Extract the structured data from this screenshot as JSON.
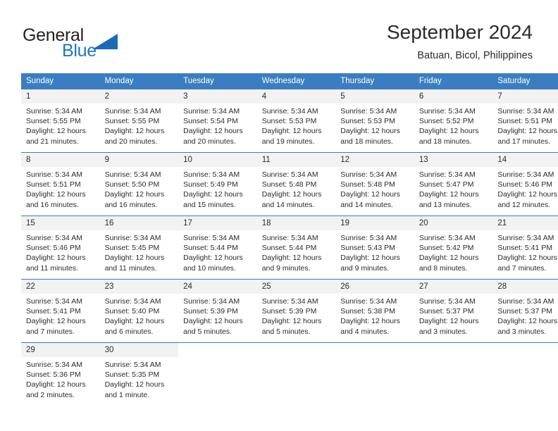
{
  "brand": {
    "word1": "General",
    "word2": "Blue",
    "accent_color": "#2077c4",
    "triangle_color": "#1b6cb5",
    "logo_icon": "general-blue-triangle-logo"
  },
  "header": {
    "title": "September 2024",
    "subtitle": "Batuan, Bicol, Philippines"
  },
  "calendar": {
    "header_bg": "#3a7ec1",
    "daynum_bg": "#f2f2f2",
    "weekday_headers": [
      "Sunday",
      "Monday",
      "Tuesday",
      "Wednesday",
      "Thursday",
      "Friday",
      "Saturday"
    ],
    "weeks": [
      [
        {
          "day": "1",
          "sunrise": "Sunrise: 5:34 AM",
          "sunset": "Sunset: 5:55 PM",
          "daylight1": "Daylight: 12 hours",
          "daylight2": "and 21 minutes."
        },
        {
          "day": "2",
          "sunrise": "Sunrise: 5:34 AM",
          "sunset": "Sunset: 5:55 PM",
          "daylight1": "Daylight: 12 hours",
          "daylight2": "and 20 minutes."
        },
        {
          "day": "3",
          "sunrise": "Sunrise: 5:34 AM",
          "sunset": "Sunset: 5:54 PM",
          "daylight1": "Daylight: 12 hours",
          "daylight2": "and 20 minutes."
        },
        {
          "day": "4",
          "sunrise": "Sunrise: 5:34 AM",
          "sunset": "Sunset: 5:53 PM",
          "daylight1": "Daylight: 12 hours",
          "daylight2": "and 19 minutes."
        },
        {
          "day": "5",
          "sunrise": "Sunrise: 5:34 AM",
          "sunset": "Sunset: 5:53 PM",
          "daylight1": "Daylight: 12 hours",
          "daylight2": "and 18 minutes."
        },
        {
          "day": "6",
          "sunrise": "Sunrise: 5:34 AM",
          "sunset": "Sunset: 5:52 PM",
          "daylight1": "Daylight: 12 hours",
          "daylight2": "and 18 minutes."
        },
        {
          "day": "7",
          "sunrise": "Sunrise: 5:34 AM",
          "sunset": "Sunset: 5:51 PM",
          "daylight1": "Daylight: 12 hours",
          "daylight2": "and 17 minutes."
        }
      ],
      [
        {
          "day": "8",
          "sunrise": "Sunrise: 5:34 AM",
          "sunset": "Sunset: 5:51 PM",
          "daylight1": "Daylight: 12 hours",
          "daylight2": "and 16 minutes."
        },
        {
          "day": "9",
          "sunrise": "Sunrise: 5:34 AM",
          "sunset": "Sunset: 5:50 PM",
          "daylight1": "Daylight: 12 hours",
          "daylight2": "and 16 minutes."
        },
        {
          "day": "10",
          "sunrise": "Sunrise: 5:34 AM",
          "sunset": "Sunset: 5:49 PM",
          "daylight1": "Daylight: 12 hours",
          "daylight2": "and 15 minutes."
        },
        {
          "day": "11",
          "sunrise": "Sunrise: 5:34 AM",
          "sunset": "Sunset: 5:48 PM",
          "daylight1": "Daylight: 12 hours",
          "daylight2": "and 14 minutes."
        },
        {
          "day": "12",
          "sunrise": "Sunrise: 5:34 AM",
          "sunset": "Sunset: 5:48 PM",
          "daylight1": "Daylight: 12 hours",
          "daylight2": "and 14 minutes."
        },
        {
          "day": "13",
          "sunrise": "Sunrise: 5:34 AM",
          "sunset": "Sunset: 5:47 PM",
          "daylight1": "Daylight: 12 hours",
          "daylight2": "and 13 minutes."
        },
        {
          "day": "14",
          "sunrise": "Sunrise: 5:34 AM",
          "sunset": "Sunset: 5:46 PM",
          "daylight1": "Daylight: 12 hours",
          "daylight2": "and 12 minutes."
        }
      ],
      [
        {
          "day": "15",
          "sunrise": "Sunrise: 5:34 AM",
          "sunset": "Sunset: 5:46 PM",
          "daylight1": "Daylight: 12 hours",
          "daylight2": "and 11 minutes."
        },
        {
          "day": "16",
          "sunrise": "Sunrise: 5:34 AM",
          "sunset": "Sunset: 5:45 PM",
          "daylight1": "Daylight: 12 hours",
          "daylight2": "and 11 minutes."
        },
        {
          "day": "17",
          "sunrise": "Sunrise: 5:34 AM",
          "sunset": "Sunset: 5:44 PM",
          "daylight1": "Daylight: 12 hours",
          "daylight2": "and 10 minutes."
        },
        {
          "day": "18",
          "sunrise": "Sunrise: 5:34 AM",
          "sunset": "Sunset: 5:44 PM",
          "daylight1": "Daylight: 12 hours",
          "daylight2": "and 9 minutes."
        },
        {
          "day": "19",
          "sunrise": "Sunrise: 5:34 AM",
          "sunset": "Sunset: 5:43 PM",
          "daylight1": "Daylight: 12 hours",
          "daylight2": "and 9 minutes."
        },
        {
          "day": "20",
          "sunrise": "Sunrise: 5:34 AM",
          "sunset": "Sunset: 5:42 PM",
          "daylight1": "Daylight: 12 hours",
          "daylight2": "and 8 minutes."
        },
        {
          "day": "21",
          "sunrise": "Sunrise: 5:34 AM",
          "sunset": "Sunset: 5:41 PM",
          "daylight1": "Daylight: 12 hours",
          "daylight2": "and 7 minutes."
        }
      ],
      [
        {
          "day": "22",
          "sunrise": "Sunrise: 5:34 AM",
          "sunset": "Sunset: 5:41 PM",
          "daylight1": "Daylight: 12 hours",
          "daylight2": "and 7 minutes."
        },
        {
          "day": "23",
          "sunrise": "Sunrise: 5:34 AM",
          "sunset": "Sunset: 5:40 PM",
          "daylight1": "Daylight: 12 hours",
          "daylight2": "and 6 minutes."
        },
        {
          "day": "24",
          "sunrise": "Sunrise: 5:34 AM",
          "sunset": "Sunset: 5:39 PM",
          "daylight1": "Daylight: 12 hours",
          "daylight2": "and 5 minutes."
        },
        {
          "day": "25",
          "sunrise": "Sunrise: 5:34 AM",
          "sunset": "Sunset: 5:39 PM",
          "daylight1": "Daylight: 12 hours",
          "daylight2": "and 5 minutes."
        },
        {
          "day": "26",
          "sunrise": "Sunrise: 5:34 AM",
          "sunset": "Sunset: 5:38 PM",
          "daylight1": "Daylight: 12 hours",
          "daylight2": "and 4 minutes."
        },
        {
          "day": "27",
          "sunrise": "Sunrise: 5:34 AM",
          "sunset": "Sunset: 5:37 PM",
          "daylight1": "Daylight: 12 hours",
          "daylight2": "and 3 minutes."
        },
        {
          "day": "28",
          "sunrise": "Sunrise: 5:34 AM",
          "sunset": "Sunset: 5:37 PM",
          "daylight1": "Daylight: 12 hours",
          "daylight2": "and 3 minutes."
        }
      ],
      [
        {
          "day": "29",
          "sunrise": "Sunrise: 5:34 AM",
          "sunset": "Sunset: 5:36 PM",
          "daylight1": "Daylight: 12 hours",
          "daylight2": "and 2 minutes."
        },
        {
          "day": "30",
          "sunrise": "Sunrise: 5:34 AM",
          "sunset": "Sunset: 5:35 PM",
          "daylight1": "Daylight: 12 hours",
          "daylight2": "and 1 minute."
        },
        {
          "day": "",
          "sunrise": "",
          "sunset": "",
          "daylight1": "",
          "daylight2": ""
        },
        {
          "day": "",
          "sunrise": "",
          "sunset": "",
          "daylight1": "",
          "daylight2": ""
        },
        {
          "day": "",
          "sunrise": "",
          "sunset": "",
          "daylight1": "",
          "daylight2": ""
        },
        {
          "day": "",
          "sunrise": "",
          "sunset": "",
          "daylight1": "",
          "daylight2": ""
        },
        {
          "day": "",
          "sunrise": "",
          "sunset": "",
          "daylight1": "",
          "daylight2": ""
        }
      ]
    ]
  }
}
